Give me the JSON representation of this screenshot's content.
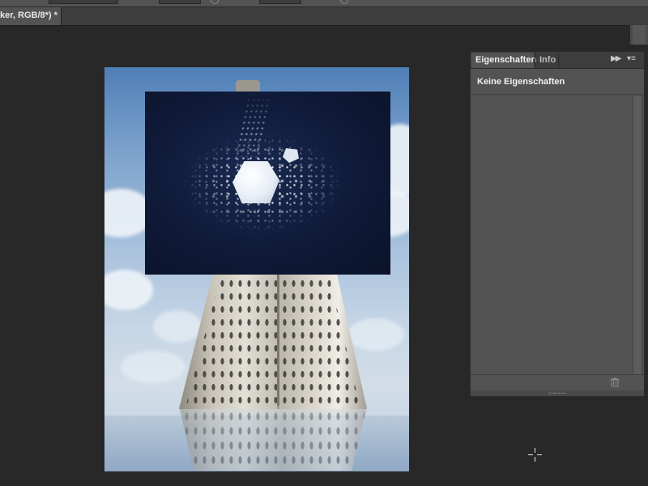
{
  "document": {
    "tab_title": "ker, RGB/8*) *"
  },
  "properties_panel": {
    "tabs": [
      {
        "label": "Eigenschaften",
        "active": true
      },
      {
        "label": "Info",
        "active": false
      }
    ],
    "collapse_icon": "double-chevron-right-icon",
    "menu_icon": "panel-menu-icon",
    "content_title": "Keine Eigenschaften",
    "footer_icon": "trash-icon"
  },
  "canvas": {
    "background_layer": "grater-on-sky-photo",
    "placed_layer": "salt-cube-splash-photo",
    "cursor_icon": "crosshair-cursor-icon"
  }
}
